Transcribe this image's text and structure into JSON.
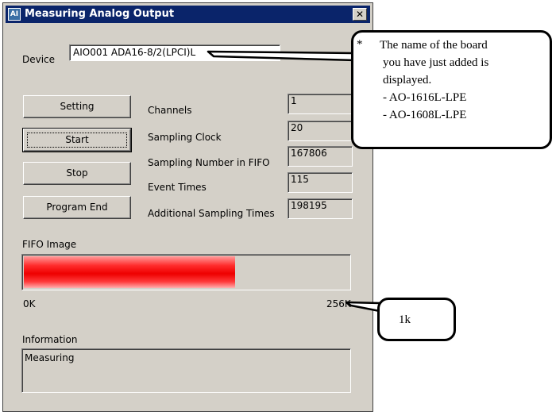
{
  "window": {
    "title": "Measuring Analog Output",
    "close_glyph": "✕",
    "icon_glyph": "AI"
  },
  "device": {
    "label": "Device",
    "value": "AIO001 ADA16-8/2(LPCI)L"
  },
  "buttons": {
    "setting": "Setting",
    "start": "Start",
    "stop": "Stop",
    "program_end": "Program End"
  },
  "params": [
    {
      "label": "Channels",
      "value": "1"
    },
    {
      "label": "Sampling Clock",
      "value": "20"
    },
    {
      "label": "Sampling Number in FIFO",
      "value": "167806"
    },
    {
      "label": "Event Times",
      "value": "115"
    },
    {
      "label": "Additional Sampling Times",
      "value": "198195"
    }
  ],
  "fifo": {
    "label": "FIFO Image",
    "min_label": "0K",
    "max_label": "256K",
    "fill_fraction": 0.65,
    "fill_color": "#ff0000"
  },
  "information": {
    "label": "Information",
    "value": "Measuring"
  },
  "callouts": {
    "board": {
      "asterisk": "*",
      "lines": [
        "The name of the board",
        "you have just added is",
        "displayed.",
        "- AO-1616L-LPE",
        "- AO-1608L-LPE"
      ]
    },
    "fifo_size": {
      "text": "1k"
    }
  }
}
